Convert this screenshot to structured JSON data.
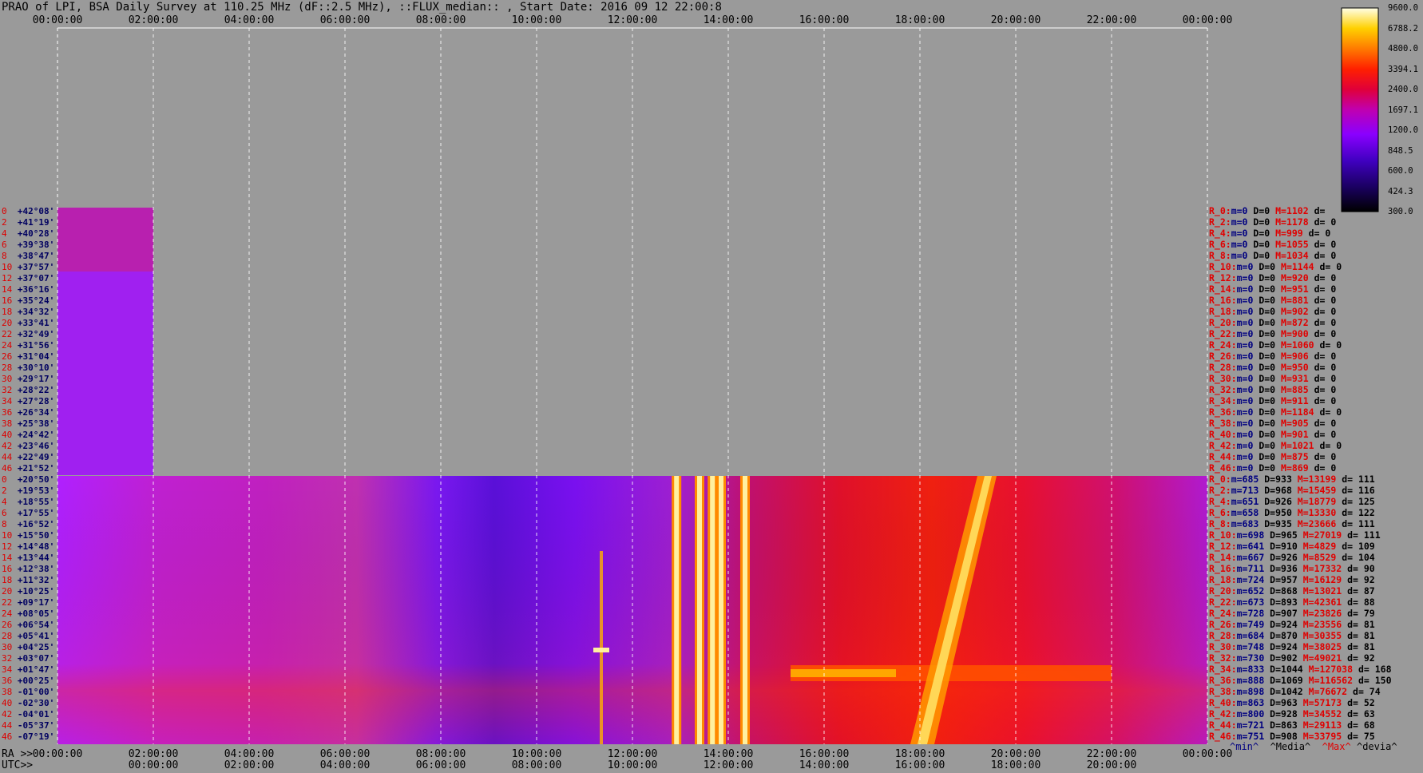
{
  "title": "PRAO of LPI, BSA Daily Survey at 110.25 MHz (dF::2.5 MHz), ::FLUX_median:: , Start Date: 2016 09 12 22:00:8",
  "top_axis_ticks": [
    "00:00:00",
    "02:00:00",
    "04:00:00",
    "06:00:00",
    "08:00:00",
    "10:00:00",
    "12:00:00",
    "14:00:00",
    "16:00:00",
    "18:00:00",
    "20:00:00",
    "22:00:00",
    "00:00:00"
  ],
  "bottom_ra_prefix": "RA >>",
  "bottom_ra_ticks": [
    "00:00:00",
    "02:00:00",
    "04:00:00",
    "06:00:00",
    "08:00:00",
    "10:00:00",
    "12:00:00",
    "14:00:00",
    "16:00:00",
    "18:00:00",
    "20:00:00",
    "22:00:00",
    "00:00:00"
  ],
  "bottom_utc_prefix": "UTC>>",
  "bottom_utc_ticks": [
    "00:00:00",
    "02:00:00",
    "04:00:00",
    "06:00:00",
    "08:00:00",
    "10:00:00",
    "12:00:00",
    "14:00:00",
    "16:00:00",
    "18:00:00",
    "20:00:00"
  ],
  "colorbar_ticks": [
    "9600.0",
    "6788.2",
    "4800.0",
    "3394.1",
    "2400.0",
    "1697.1",
    "1200.0",
    "848.5",
    "600.0",
    "424.3",
    "300.0"
  ],
  "legend_footer": {
    "min": "^min^",
    "median": "^Media^",
    "max": "^Max^",
    "dev": "^devia^"
  },
  "upper_rows": [
    {
      "idx": "0",
      "dec": "+42°08'"
    },
    {
      "idx": "2",
      "dec": "+41°19'"
    },
    {
      "idx": "4",
      "dec": "+40°28'"
    },
    {
      "idx": "6",
      "dec": "+39°38'"
    },
    {
      "idx": "8",
      "dec": "+38°47'"
    },
    {
      "idx": "10",
      "dec": "+37°57'"
    },
    {
      "idx": "12",
      "dec": "+37°07'"
    },
    {
      "idx": "14",
      "dec": "+36°16'"
    },
    {
      "idx": "16",
      "dec": "+35°24'"
    },
    {
      "idx": "18",
      "dec": "+34°32'"
    },
    {
      "idx": "20",
      "dec": "+33°41'"
    },
    {
      "idx": "22",
      "dec": "+32°49'"
    },
    {
      "idx": "24",
      "dec": "+31°56'"
    },
    {
      "idx": "26",
      "dec": "+31°04'"
    },
    {
      "idx": "28",
      "dec": "+30°10'"
    },
    {
      "idx": "30",
      "dec": "+29°17'"
    },
    {
      "idx": "32",
      "dec": "+28°22'"
    },
    {
      "idx": "34",
      "dec": "+27°28'"
    },
    {
      "idx": "36",
      "dec": "+26°34'"
    },
    {
      "idx": "38",
      "dec": "+25°38'"
    },
    {
      "idx": "40",
      "dec": "+24°42'"
    },
    {
      "idx": "42",
      "dec": "+23°46'"
    },
    {
      "idx": "44",
      "dec": "+22°49'"
    },
    {
      "idx": "46",
      "dec": "+21°52'"
    }
  ],
  "lower_rows": [
    {
      "idx": "0",
      "dec": "+20°50'"
    },
    {
      "idx": "2",
      "dec": "+19°53'"
    },
    {
      "idx": "4",
      "dec": "+18°55'"
    },
    {
      "idx": "6",
      "dec": "+17°55'"
    },
    {
      "idx": "8",
      "dec": "+16°52'"
    },
    {
      "idx": "10",
      "dec": "+15°50'"
    },
    {
      "idx": "12",
      "dec": "+14°48'"
    },
    {
      "idx": "14",
      "dec": "+13°44'"
    },
    {
      "idx": "16",
      "dec": "+12°38'"
    },
    {
      "idx": "18",
      "dec": "+11°32'"
    },
    {
      "idx": "20",
      "dec": "+10°25'"
    },
    {
      "idx": "22",
      "dec": "+09°17'"
    },
    {
      "idx": "24",
      "dec": "+08°05'"
    },
    {
      "idx": "26",
      "dec": "+06°54'"
    },
    {
      "idx": "28",
      "dec": "+05°41'"
    },
    {
      "idx": "30",
      "dec": "+04°25'"
    },
    {
      "idx": "32",
      "dec": "+03°07'"
    },
    {
      "idx": "34",
      "dec": "+01°47'"
    },
    {
      "idx": "36",
      "dec": "+00°25'"
    },
    {
      "idx": "38",
      "dec": "-01°00'"
    },
    {
      "idx": "40",
      "dec": "-02°30'"
    },
    {
      "idx": "42",
      "dec": "-04°01'"
    },
    {
      "idx": "44",
      "dec": "-05°37'"
    },
    {
      "idx": "46",
      "dec": "-07°19'"
    }
  ],
  "upper_stats": [
    {
      "r": "R_0:",
      "m": "m=0",
      "D": "D=0",
      "M": "M=1102",
      "d": "d="
    },
    {
      "r": "R_2:",
      "m": "m=0",
      "D": "D=0",
      "M": "M=1178",
      "d": "d= 0"
    },
    {
      "r": "R_4:",
      "m": "m=0",
      "D": "D=0",
      "M": "M=999",
      "d": "d= 0"
    },
    {
      "r": "R_6:",
      "m": "m=0",
      "D": "D=0",
      "M": "M=1055",
      "d": "d= 0"
    },
    {
      "r": "R_8:",
      "m": "m=0",
      "D": "D=0",
      "M": "M=1034",
      "d": "d= 0"
    },
    {
      "r": "R_10:",
      "m": "m=0",
      "D": "D=0",
      "M": "M=1144",
      "d": "d= 0"
    },
    {
      "r": "R_12:",
      "m": "m=0",
      "D": "D=0",
      "M": "M=920",
      "d": "d= 0"
    },
    {
      "r": "R_14:",
      "m": "m=0",
      "D": "D=0",
      "M": "M=951",
      "d": "d= 0"
    },
    {
      "r": "R_16:",
      "m": "m=0",
      "D": "D=0",
      "M": "M=881",
      "d": "d= 0"
    },
    {
      "r": "R_18:",
      "m": "m=0",
      "D": "D=0",
      "M": "M=902",
      "d": "d= 0"
    },
    {
      "r": "R_20:",
      "m": "m=0",
      "D": "D=0",
      "M": "M=872",
      "d": "d= 0"
    },
    {
      "r": "R_22:",
      "m": "m=0",
      "D": "D=0",
      "M": "M=900",
      "d": "d= 0"
    },
    {
      "r": "R_24:",
      "m": "m=0",
      "D": "D=0",
      "M": "M=1060",
      "d": "d= 0"
    },
    {
      "r": "R_26:",
      "m": "m=0",
      "D": "D=0",
      "M": "M=906",
      "d": "d= 0"
    },
    {
      "r": "R_28:",
      "m": "m=0",
      "D": "D=0",
      "M": "M=950",
      "d": "d= 0"
    },
    {
      "r": "R_30:",
      "m": "m=0",
      "D": "D=0",
      "M": "M=931",
      "d": "d= 0"
    },
    {
      "r": "R_32:",
      "m": "m=0",
      "D": "D=0",
      "M": "M=885",
      "d": "d= 0"
    },
    {
      "r": "R_34:",
      "m": "m=0",
      "D": "D=0",
      "M": "M=911",
      "d": "d= 0"
    },
    {
      "r": "R_36:",
      "m": "m=0",
      "D": "D=0",
      "M": "M=1184",
      "d": "d= 0"
    },
    {
      "r": "R_38:",
      "m": "m=0",
      "D": "D=0",
      "M": "M=905",
      "d": "d= 0"
    },
    {
      "r": "R_40:",
      "m": "m=0",
      "D": "D=0",
      "M": "M=901",
      "d": "d= 0"
    },
    {
      "r": "R_42:",
      "m": "m=0",
      "D": "D=0",
      "M": "M=1021",
      "d": "d= 0"
    },
    {
      "r": "R_44:",
      "m": "m=0",
      "D": "D=0",
      "M": "M=875",
      "d": "d= 0"
    },
    {
      "r": "R_46:",
      "m": "m=0",
      "D": "D=0",
      "M": "M=869",
      "d": "d= 0"
    }
  ],
  "lower_stats": [
    {
      "r": "R_0:",
      "m": "m=685",
      "D": "D=933",
      "M": "M=13199",
      "d": "d= 111"
    },
    {
      "r": "R_2:",
      "m": "m=713",
      "D": "D=968",
      "M": "M=15459",
      "d": "d= 116"
    },
    {
      "r": "R_4:",
      "m": "m=651",
      "D": "D=926",
      "M": "M=18779",
      "d": "d= 125"
    },
    {
      "r": "R_6:",
      "m": "m=658",
      "D": "D=950",
      "M": "M=13330",
      "d": "d= 122"
    },
    {
      "r": "R_8:",
      "m": "m=683",
      "D": "D=935",
      "M": "M=23666",
      "d": "d= 111"
    },
    {
      "r": "R_10:",
      "m": "m=698",
      "D": "D=965",
      "M": "M=27019",
      "d": "d= 111"
    },
    {
      "r": "R_12:",
      "m": "m=641",
      "D": "D=910",
      "M": "M=4829",
      "d": "d= 109"
    },
    {
      "r": "R_14:",
      "m": "m=667",
      "D": "D=926",
      "M": "M=8529",
      "d": "d= 104"
    },
    {
      "r": "R_16:",
      "m": "m=711",
      "D": "D=936",
      "M": "M=17332",
      "d": "d= 90"
    },
    {
      "r": "R_18:",
      "m": "m=724",
      "D": "D=957",
      "M": "M=16129",
      "d": "d= 92"
    },
    {
      "r": "R_20:",
      "m": "m=652",
      "D": "D=868",
      "M": "M=13021",
      "d": "d= 87"
    },
    {
      "r": "R_22:",
      "m": "m=673",
      "D": "D=893",
      "M": "M=42361",
      "d": "d= 88"
    },
    {
      "r": "R_24:",
      "m": "m=728",
      "D": "D=907",
      "M": "M=23826",
      "d": "d= 79"
    },
    {
      "r": "R_26:",
      "m": "m=749",
      "D": "D=924",
      "M": "M=23556",
      "d": "d= 81"
    },
    {
      "r": "R_28:",
      "m": "m=684",
      "D": "D=870",
      "M": "M=30355",
      "d": "d= 81"
    },
    {
      "r": "R_30:",
      "m": "m=748",
      "D": "D=924",
      "M": "M=38025",
      "d": "d= 81"
    },
    {
      "r": "R_32:",
      "m": "m=730",
      "D": "D=902",
      "M": "M=49021",
      "d": "d= 92"
    },
    {
      "r": "R_34:",
      "m": "m=833",
      "D": "D=1044",
      "M": "M=127038",
      "d": "d= 168"
    },
    {
      "r": "R_36:",
      "m": "m=888",
      "D": "D=1069",
      "M": "M=116562",
      "d": "d= 150"
    },
    {
      "r": "R_38:",
      "m": "m=898",
      "D": "D=1042",
      "M": "M=76672",
      "d": "d= 74"
    },
    {
      "r": "R_40:",
      "m": "m=863",
      "D": "D=963",
      "M": "M=57173",
      "d": "d= 52"
    },
    {
      "r": "R_42:",
      "m": "m=800",
      "D": "D=928",
      "M": "M=34552",
      "d": "d= 63"
    },
    {
      "r": "R_44:",
      "m": "m=721",
      "D": "D=863",
      "M": "M=29113",
      "d": "d= 68"
    },
    {
      "r": "R_46:",
      "m": "m=751",
      "D": "D=908",
      "M": "M=33795",
      "d": "d= 75"
    }
  ],
  "chart_data": {
    "type": "heatmap",
    "title": "PRAO of LPI, BSA Daily Survey at 110.25 MHz (dF::2.5 MHz), ::FLUX_median:: , Start Date: 2016 09 12 22:00:8",
    "x_range_hours": [
      0,
      24
    ],
    "colorscale_range": [
      300.0,
      9600.0
    ],
    "log_scale_colorbar": true,
    "upper_block_time_range_hours": [
      0,
      2
    ],
    "lower_block_time_range_hours": [
      0,
      24
    ],
    "features": {
      "vertical_bursts_hours": [
        12.92,
        13.4,
        13.67,
        13.85,
        14.35
      ],
      "bright_band_hours": [
        15.3,
        22.0
      ],
      "diagonal_source_hours": [
        17.8,
        19.6
      ]
    },
    "grid": true
  }
}
